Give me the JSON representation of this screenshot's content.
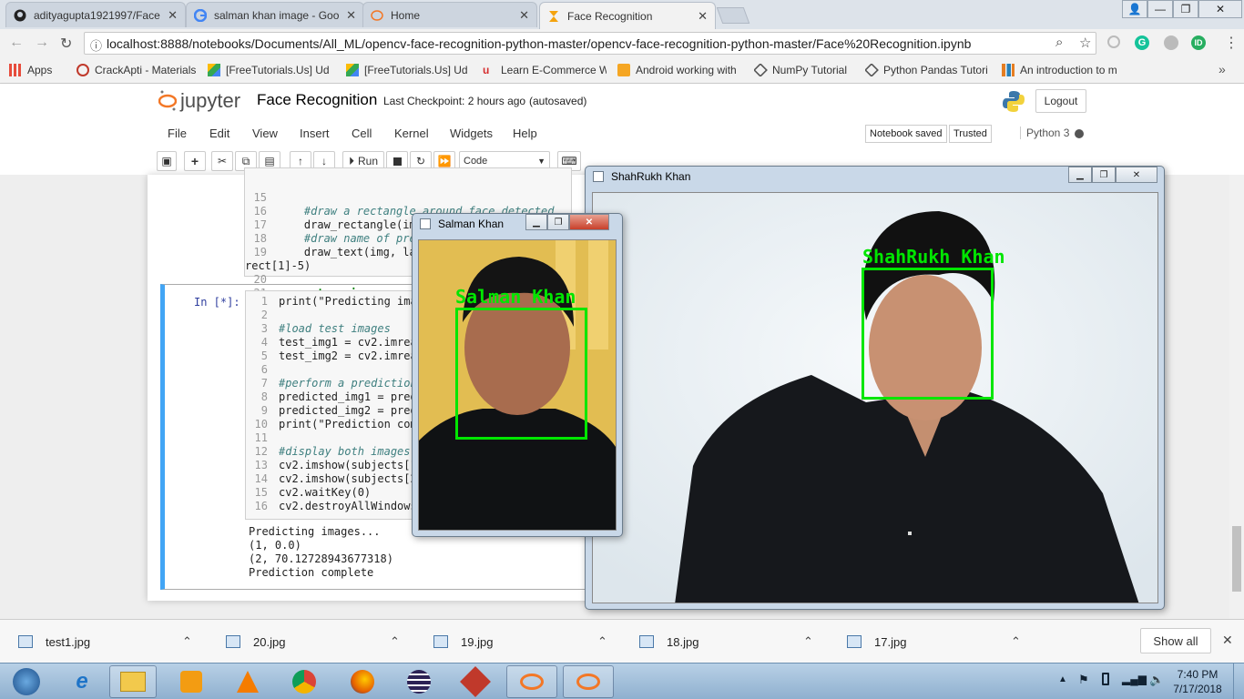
{
  "browser": {
    "tabs": [
      {
        "title": "adityagupta1921997/Face",
        "icon": "github-icon"
      },
      {
        "title": "salman khan image - Goo",
        "icon": "google-icon"
      },
      {
        "title": "Home",
        "icon": "jupyter-icon"
      },
      {
        "title": "Face Recognition",
        "icon": "hourglass-icon"
      }
    ],
    "url": "localhost:8888/notebooks/Documents/All_ML/opencv-face-recognition-python-master/opencv-face-recognition-python-master/Face%20Recognition.ipynb",
    "bookmarks": [
      {
        "label": "Apps"
      },
      {
        "label": "CrackApti - Materials"
      },
      {
        "label": "[FreeTutorials.Us] Ud"
      },
      {
        "label": "[FreeTutorials.Us] Ud"
      },
      {
        "label": "Learn E-Commerce W"
      },
      {
        "label": "Android working with"
      },
      {
        "label": "NumPy Tutorial"
      },
      {
        "label": "Python Pandas Tutori"
      },
      {
        "label": "An introduction to m"
      }
    ]
  },
  "jupyter": {
    "brand": "jupyter",
    "notebook_name": "Face Recognition",
    "checkpoint": "Last Checkpoint: 2 hours ago",
    "autosave": "(autosaved)",
    "logout": "Logout",
    "menu": [
      "File",
      "Edit",
      "View",
      "Insert",
      "Cell",
      "Kernel",
      "Widgets",
      "Help"
    ],
    "status_saved": "Notebook saved",
    "trusted": "Trusted",
    "kernel": "Python 3",
    "toolbar": {
      "run": "Run",
      "cell_type": "Code"
    },
    "cell1": {
      "lines": [
        {
          "n": "15",
          "text": ""
        },
        {
          "n": "16",
          "text": "#draw a rectangle around face detected"
        },
        {
          "n": "17",
          "text": "draw_rectangle(img, rect)"
        },
        {
          "n": "18",
          "text": "#draw name of predicted person"
        },
        {
          "n": "19",
          "text": "draw_text(img, label_text, rect[0], rect[1]-5)"
        },
        {
          "n": "20",
          "text": ""
        },
        {
          "n": "21",
          "text": "return img"
        }
      ]
    },
    "cell2": {
      "prompt": "In [*]:",
      "lines": [
        {
          "n": "1",
          "text": "print(\"Predicting images...\")"
        },
        {
          "n": "2",
          "text": ""
        },
        {
          "n": "3",
          "text": "#load test images"
        },
        {
          "n": "4",
          "text": "test_img1 = cv2.imread("
        },
        {
          "n": "5",
          "text": "test_img2 = cv2.imread("
        },
        {
          "n": "6",
          "text": ""
        },
        {
          "n": "7",
          "text": "#perform a prediction"
        },
        {
          "n": "8",
          "text": "predicted_img1 = predi"
        },
        {
          "n": "9",
          "text": "predicted_img2 = predi"
        },
        {
          "n": "10",
          "text": "print(\"Prediction comp"
        },
        {
          "n": "11",
          "text": ""
        },
        {
          "n": "12",
          "text": "#display both images"
        },
        {
          "n": "13",
          "text": "cv2.imshow(subjects[1]"
        },
        {
          "n": "14",
          "text": "cv2.imshow(subjects[2]"
        },
        {
          "n": "15",
          "text": "cv2.waitKey(0)"
        },
        {
          "n": "16",
          "text": "cv2.destroyAllWindows("
        }
      ],
      "output": [
        "Predicting images...",
        "(1, 0.0)",
        "(2, 70.12728943677318)",
        "Prediction complete"
      ]
    }
  },
  "windows": {
    "shahrukh": {
      "title": "ShahRukh Khan",
      "label": "ShahRukh Khan"
    },
    "salman": {
      "title": "Salman Khan",
      "label": "Salman Khan"
    }
  },
  "downloads": {
    "items": [
      "test1.jpg",
      "20.jpg",
      "19.jpg",
      "18.jpg",
      "17.jpg"
    ],
    "show_all": "Show all"
  },
  "taskbar": {
    "time": "7:40 PM",
    "date": "7/17/2018"
  },
  "colors": {
    "face_box": "#00e600",
    "cell_selected": "#42a5f5"
  }
}
